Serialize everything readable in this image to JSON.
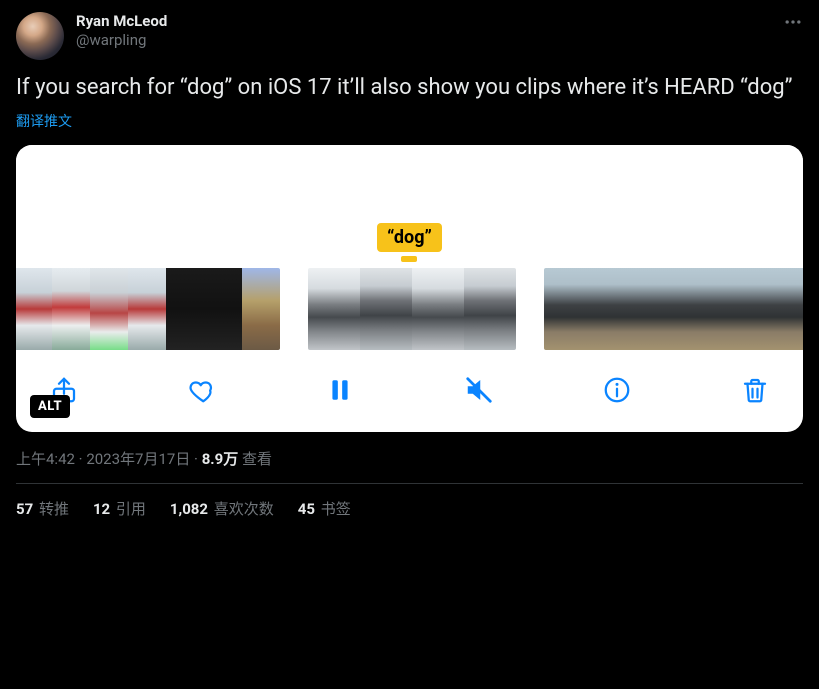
{
  "author": {
    "display_name": "Ryan McLeod",
    "handle": "@warpling"
  },
  "tweet_text": "If you search for “dog” on iOS 17 it’ll also show you clips where it’s HEARD “dog”",
  "translate_label": "翻译推文",
  "media": {
    "highlight_label": "“dog”",
    "alt_badge": "ALT",
    "toolbar": {
      "share_label": "Share",
      "like_label": "Like",
      "pause_label": "Pause",
      "mute_label": "Muted",
      "info_label": "Info",
      "trash_label": "Delete"
    }
  },
  "meta": {
    "time": "上午4:42",
    "sep1": " · ",
    "date": "2023年7月17日",
    "sep2": " · ",
    "views_count": "8.9万",
    "views_label": " 查看"
  },
  "stats": {
    "retweets_count": "57",
    "retweets_label": " 转推",
    "quotes_count": "12",
    "quotes_label": " 引用",
    "likes_count": "1,082",
    "likes_label": " 喜欢次数",
    "bookmarks_count": "45",
    "bookmarks_label": " 书签"
  }
}
